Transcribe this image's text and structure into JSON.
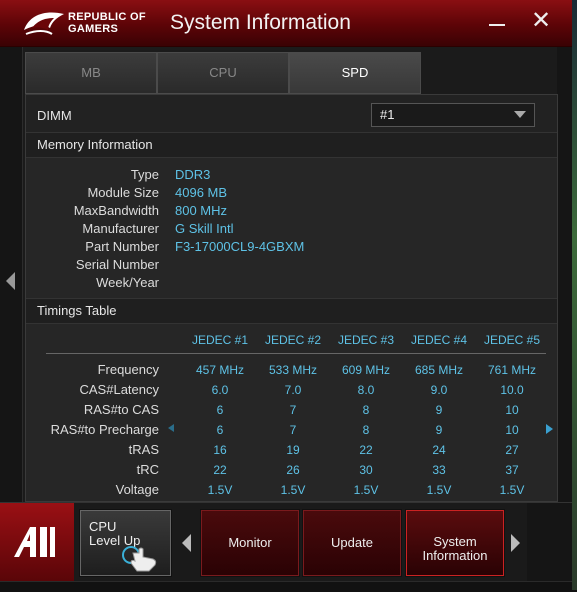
{
  "window": {
    "brand_line1": "REPUBLIC OF",
    "brand_line2": "GAMERS",
    "title": "System Information"
  },
  "tabs": [
    {
      "label": "MB",
      "active": false
    },
    {
      "label": "CPU",
      "active": false
    },
    {
      "label": "SPD",
      "active": true
    }
  ],
  "dimm": {
    "label": "DIMM",
    "selected": "#1"
  },
  "memory_info": {
    "heading": "Memory Information",
    "rows": [
      {
        "key": "Type",
        "value": "DDR3"
      },
      {
        "key": "Module Size",
        "value": "4096 MB"
      },
      {
        "key": "MaxBandwidth",
        "value": "800 MHz"
      },
      {
        "key": "Manufacturer",
        "value": "G Skill Intl"
      },
      {
        "key": "Part Number",
        "value": "F3-17000CL9-4GBXM"
      },
      {
        "key": "Serial Number",
        "value": ""
      },
      {
        "key": "Week/Year",
        "value": ""
      }
    ]
  },
  "timings": {
    "heading": "Timings Table",
    "columns": [
      "JEDEC #1",
      "JEDEC #2",
      "JEDEC #3",
      "JEDEC #4",
      "JEDEC #5"
    ],
    "rows": [
      {
        "label": "Frequency",
        "values": [
          "457 MHz",
          "533 MHz",
          "609 MHz",
          "685 MHz",
          "761 MHz"
        ]
      },
      {
        "label": "CAS#Latency",
        "values": [
          "6.0",
          "7.0",
          "8.0",
          "9.0",
          "10.0"
        ]
      },
      {
        "label": "RAS#to CAS",
        "values": [
          "6",
          "7",
          "8",
          "9",
          "10"
        ]
      },
      {
        "label": "RAS#to Precharge",
        "values": [
          "6",
          "7",
          "8",
          "9",
          "10"
        ]
      },
      {
        "label": "tRAS",
        "values": [
          "16",
          "19",
          "22",
          "24",
          "27"
        ]
      },
      {
        "label": "tRC",
        "values": [
          "22",
          "26",
          "30",
          "33",
          "37"
        ]
      },
      {
        "label": "Voltage",
        "values": [
          "1.5V",
          "1.5V",
          "1.5V",
          "1.5V",
          "1.5V"
        ]
      }
    ]
  },
  "bottom": {
    "cpu_level_up": "CPU Level Up",
    "monitor": "Monitor",
    "update": "Update",
    "system_information": "System Information"
  },
  "colors": {
    "accent_red": "#8a0f12",
    "value_blue": "#5ec2e6"
  }
}
